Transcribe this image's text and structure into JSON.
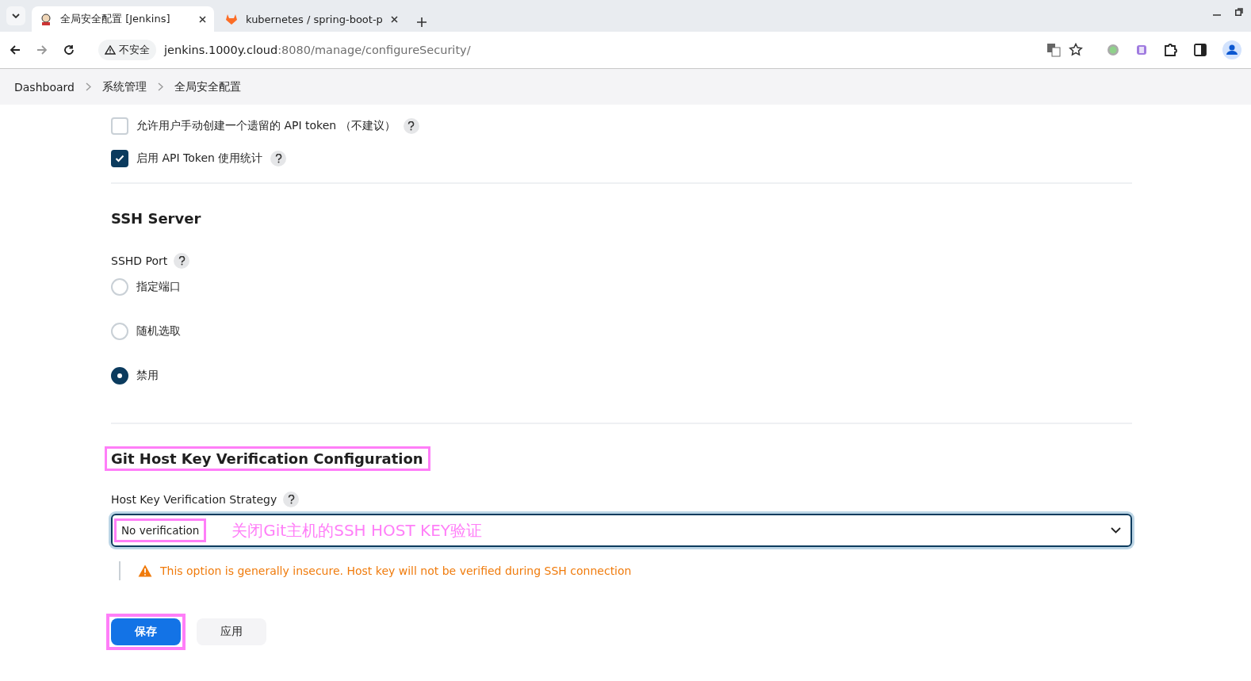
{
  "browser": {
    "tabs": [
      {
        "title": "全局安全配置 [Jenkins]",
        "selected": true
      },
      {
        "title": "kubernetes / spring-boot-p",
        "selected": false
      }
    ],
    "security_label": "不安全",
    "url_host": "jenkins.1000y.cloud",
    "url_path": ":8080/manage/configureSecurity/"
  },
  "breadcrumb": [
    "Dashboard",
    "系统管理",
    "全局安全配置"
  ],
  "checkboxes": [
    {
      "label": "允许用户手动创建一个遗留的 API token （不建议）",
      "checked": false
    },
    {
      "label": "启用 API Token 使用统计",
      "checked": true
    }
  ],
  "ssh_server": {
    "heading": "SSH Server",
    "field_label": "SSHD Port",
    "options": [
      {
        "label": "指定端口",
        "selected": false
      },
      {
        "label": "随机选取",
        "selected": false
      },
      {
        "label": "禁用",
        "selected": true
      }
    ]
  },
  "git_host_key": {
    "heading": "Git Host Key Verification Configuration",
    "heading_annotated": true,
    "field_label": "Host Key Verification Strategy",
    "select_value": "No verification",
    "select_annotated": true,
    "warning": "This option is generally insecure. Host key will not be verified during SSH connection"
  },
  "annotation": {
    "text": "关闭Git主机的SSH HOST KEY验证"
  },
  "buttons": [
    {
      "label": "保存",
      "kind": "primary",
      "annotated": true
    },
    {
      "label": "应用",
      "kind": "secondary",
      "annotated": false
    }
  ]
}
